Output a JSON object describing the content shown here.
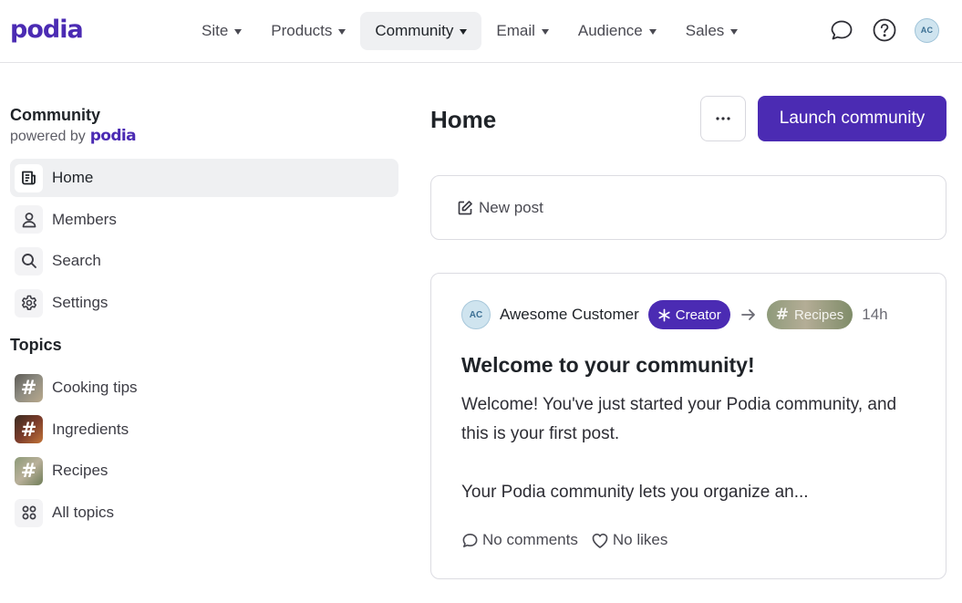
{
  "app": {
    "logo_text": "podia",
    "brand_color": "#4b2bb3"
  },
  "nav": {
    "items": [
      {
        "label": "Site"
      },
      {
        "label": "Products"
      },
      {
        "label": "Community",
        "active": true
      },
      {
        "label": "Email"
      },
      {
        "label": "Audience"
      },
      {
        "label": "Sales"
      }
    ]
  },
  "user": {
    "initials": "AC"
  },
  "sidebar": {
    "title": "Community",
    "powered_by": "powered by",
    "powered_logo": "podia",
    "items": [
      {
        "label": "Home",
        "icon": "post-icon",
        "active": true
      },
      {
        "label": "Members",
        "icon": "person-icon"
      },
      {
        "label": "Search",
        "icon": "search-icon"
      },
      {
        "label": "Settings",
        "icon": "gear-icon"
      }
    ],
    "topics_title": "Topics",
    "topics": [
      {
        "label": "Cooking tips",
        "icon": "hashtag-icon"
      },
      {
        "label": "Ingredients",
        "icon": "hashtag-icon"
      },
      {
        "label": "Recipes",
        "icon": "hashtag-icon"
      },
      {
        "label": "All topics",
        "icon": "grid-icon"
      }
    ]
  },
  "main": {
    "title": "Home",
    "more_label": "···",
    "launch_label": "Launch community",
    "new_post_label": "New post"
  },
  "post": {
    "author_initials": "AC",
    "author": "Awesome Customer",
    "badge": "Creator",
    "topic": "Recipes",
    "time": "14h",
    "title": "Welcome to your community!",
    "body_line1": "Welcome! You've just started your Podia community, and this is your first post.",
    "body_line2": "Your Podia community lets you organize an...",
    "comments": "No comments",
    "likes": "No likes"
  }
}
